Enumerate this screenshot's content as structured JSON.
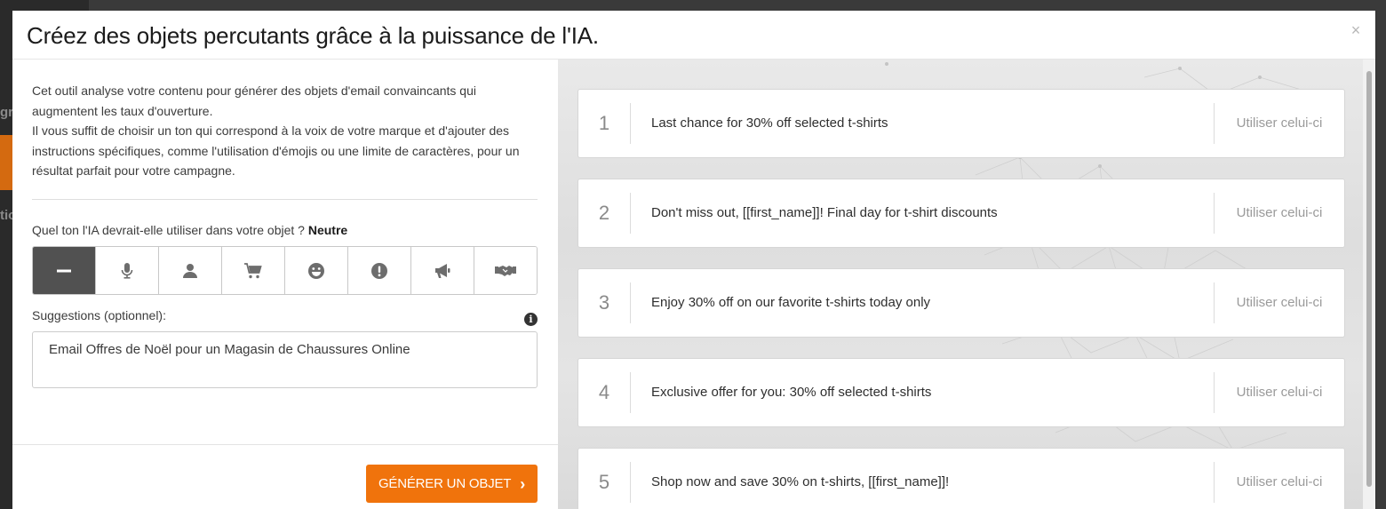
{
  "background": {
    "fragments": [
      "gr",
      "s",
      "tio"
    ]
  },
  "modal": {
    "title": "Créez des objets percutants grâce à la puissance de l'IA.",
    "close_label": "×"
  },
  "left_panel": {
    "description": [
      "Cet outil analyse votre contenu pour générer des objets d'email convaincants qui augmentent les taux d'ouverture.",
      "Il vous suffit de choisir un ton qui correspond à la voix de votre marque et d'ajouter des instructions spécifiques, comme l'utilisation d'émojis ou une limite de caractères, pour un résultat parfait pour votre campagne."
    ],
    "tone_question": "Quel ton l'IA devrait-elle utiliser dans votre objet ?",
    "tone_selected": "Neutre",
    "tones": [
      {
        "icon": "minus-icon",
        "active": true
      },
      {
        "icon": "microphone-icon",
        "active": false
      },
      {
        "icon": "person-icon",
        "active": false
      },
      {
        "icon": "cart-icon",
        "active": false
      },
      {
        "icon": "smile-icon",
        "active": false
      },
      {
        "icon": "exclamation-icon",
        "active": false
      },
      {
        "icon": "megaphone-icon",
        "active": false
      },
      {
        "icon": "handshake-icon",
        "active": false
      }
    ],
    "suggestions_label": "Suggestions (optionnel):",
    "info_glyph": "i",
    "suggestions_value": "Email Offres de Noël pour un Magasin de Chaussures Online",
    "generate_label": "GÉNÉRER UN OBJET",
    "generate_chevron": "›",
    "accent_color": "#f0730c"
  },
  "results": [
    {
      "num": "1",
      "text": "Last chance for 30% off selected t-shirts",
      "action": "Utiliser celui-ci"
    },
    {
      "num": "2",
      "text": "Don't miss out, [[first_name]]! Final day for t-shirt discounts",
      "action": "Utiliser celui-ci"
    },
    {
      "num": "3",
      "text": "Enjoy 30% off on our favorite t-shirts today only",
      "action": "Utiliser celui-ci"
    },
    {
      "num": "4",
      "text": "Exclusive offer for you: 30% off selected t-shirts",
      "action": "Utiliser celui-ci"
    },
    {
      "num": "5",
      "text": "Shop now and save 30% on t-shirts, [[first_name]]!",
      "action": "Utiliser celui-ci"
    }
  ]
}
